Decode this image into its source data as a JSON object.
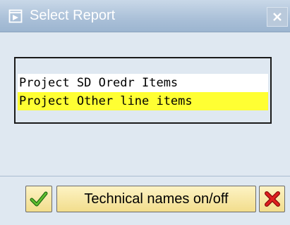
{
  "dialog": {
    "title": "Select Report",
    "title_icon": "report-select-icon",
    "close_icon": "close-icon"
  },
  "list": {
    "items": [
      {
        "label": "Project SD Oredr Items",
        "selected": false
      },
      {
        "label": "Project Other line items",
        "selected": true
      }
    ],
    "highlight_color": "#ffff33"
  },
  "buttons": {
    "ok_icon": "checkmark-icon",
    "technical_names_label": "Technical names on/off",
    "cancel_icon": "cancel-x-icon"
  },
  "colors": {
    "titlebar": "#aac0d8",
    "background": "#dfe8f1",
    "button": "#f2dd8c"
  }
}
